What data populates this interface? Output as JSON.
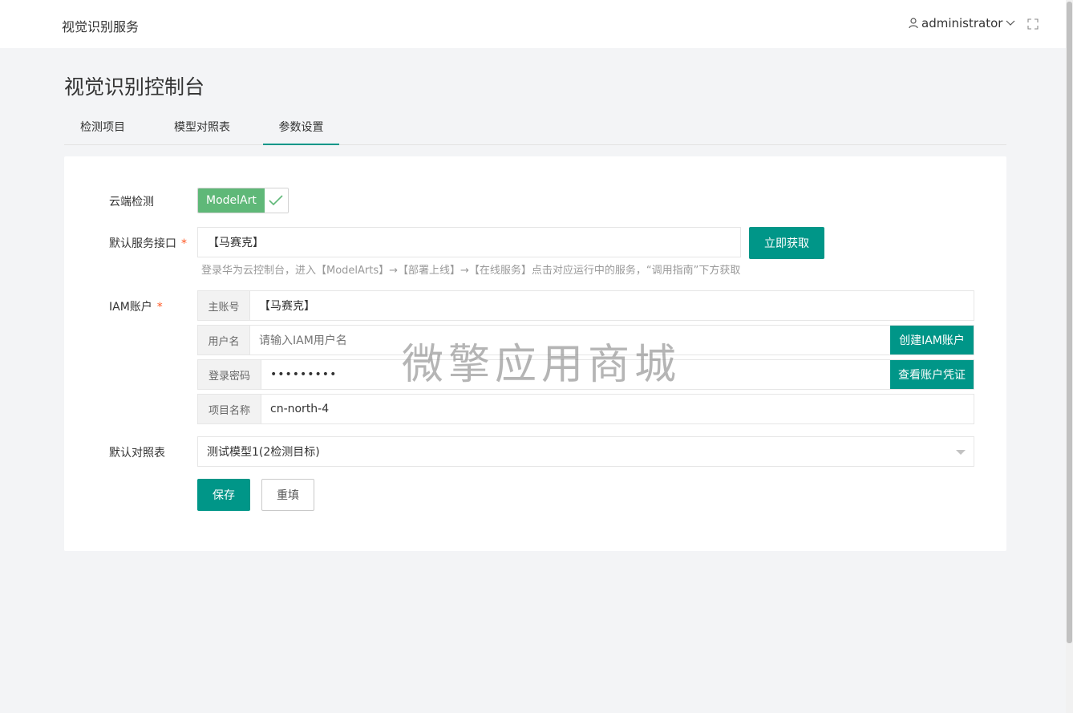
{
  "header": {
    "app_title": "视觉识别服务",
    "username": "administrator"
  },
  "page": {
    "title": "视觉识别控制台",
    "tabs": [
      {
        "label": "检测项目",
        "active": false
      },
      {
        "label": "模型对照表",
        "active": false
      },
      {
        "label": "参数设置",
        "active": true
      }
    ]
  },
  "form": {
    "cloud_detect": {
      "label": "云端检测",
      "toggle_text": "ModelArt",
      "checked": true
    },
    "service_endpoint": {
      "label": "默认服务接口",
      "value": "【马赛克】",
      "button": "立即获取",
      "hint": "登录华为云控制台，进入【ModelArts】→【部署上线】→【在线服务】点击对应运行中的服务，“调用指南”下方获取"
    },
    "iam": {
      "label": "IAM账户",
      "main_account_label": "主账号",
      "main_account_value": "【马赛克】",
      "username_label": "用户名",
      "username_placeholder": "请输入IAM用户名",
      "create_button": "创建IAM账户",
      "password_label": "登录密码",
      "password_value": "•••••••••",
      "view_credentials_button": "查看账户凭证",
      "project_label": "项目名称",
      "project_value": "cn-north-4"
    },
    "default_table": {
      "label": "默认对照表",
      "selected": "测试模型1(2检测目标)"
    },
    "save_button": "保存",
    "reset_button": "重填"
  },
  "watermark": "微擎应用商城",
  "colors": {
    "primary": "#009688",
    "toggle": "#5fb878",
    "required": "#ff5722"
  }
}
